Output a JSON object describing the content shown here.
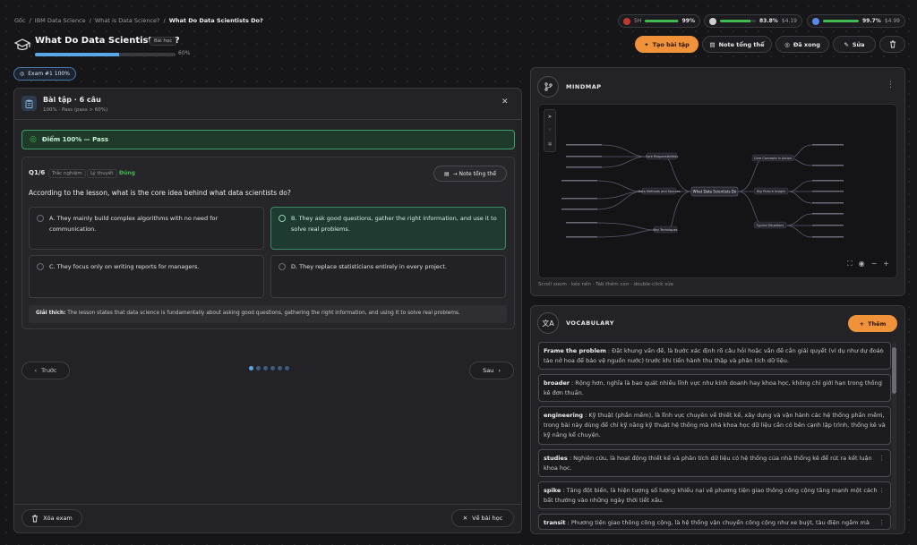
{
  "breadcrumb": [
    "Gốc",
    "IBM Data Science",
    "What is Data Science?",
    "What Do Data Scientists Do?"
  ],
  "breadcrumb_sep": "/",
  "header": {
    "title": "What Do Data Scientists Do?",
    "tag": "Bài học",
    "progress_pct": 60,
    "progress_text": "60%"
  },
  "quotas": [
    {
      "label": "5H",
      "pct": 99,
      "pct_text": "99%",
      "cost": "",
      "icon_color": "#c0392b"
    },
    {
      "label": "",
      "pct": 83.8,
      "pct_text": "83.8%",
      "cost": "$4.19",
      "icon_color": "#d0d0d4"
    },
    {
      "label": "",
      "pct": 99.7,
      "pct_text": "99.7%",
      "cost": "$4.99",
      "icon_color": "#5a8ae8"
    }
  ],
  "toolbar": {
    "create": "Tạo bài tập",
    "note": "Note tổng thể",
    "done": "Đã xong",
    "edit": "Sửa"
  },
  "exam_chip": "Exam #1  100%",
  "quiz": {
    "title": "Bài tập · 6 câu",
    "subtitle": "100% · Pass (pass > 60%)",
    "banner": "Điểm 100% — Pass",
    "q_number": "Q1/6",
    "type": "Trắc nghiệm",
    "category": "Lý thuyết",
    "result": "Đúng",
    "note_button": "→ Note tổng thể",
    "question": "According to the lesson, what is the core idea behind what data scientists do?",
    "options": [
      {
        "text": "A. They mainly build complex algorithms with no need for communication.",
        "correct": false
      },
      {
        "text": "B. They ask good questions, gather the right information, and use it to solve real problems.",
        "correct": true
      },
      {
        "text": "C. They focus only on writing reports for managers.",
        "correct": false
      },
      {
        "text": "D. They replace statisticians entirely in every project.",
        "correct": false
      }
    ],
    "explain_label": "Giải thích:",
    "explain_text": " The lesson states that data science is fundamentally about asking good questions, gathering the right information, and using it to solve real problems.",
    "prev": "Trước",
    "next": "Sau",
    "page_count": 6,
    "active_page": 1,
    "delete": "Xóa exam",
    "back": "Về bài học"
  },
  "mindmap": {
    "title": "MINDMAP",
    "root": "What Data Scientists Do",
    "branches": [
      "Core Responsibilities",
      "Data Methods and Sources",
      "Key Techniques",
      "Core Concepts in Action",
      "Big Picture Insight",
      "Typical Situations"
    ],
    "hint": "Scroll zoom · kéo nền · Tab thêm con · double-click sửa"
  },
  "vocab": {
    "title": "VOCABULARY",
    "add": "Thêm",
    "items": [
      {
        "term": "Frame the problem",
        "def": " : Đặt khung vấn đề, là bước xác định rõ câu hỏi hoặc vấn đề cần giải quyết (ví dụ như dự đoán tảo nở hoa để bảo vệ nguồn nước) trước khi tiến hành thu thập và phân tích dữ liệu."
      },
      {
        "term": "broader",
        "def": " : Rộng hơn, nghĩa là bao quát nhiều lĩnh vực như kinh doanh hay khoa học, không chỉ giới hạn trong thống kê đơn thuần."
      },
      {
        "term": "engineering",
        "def": " : Kỹ thuật (phần mềm), là lĩnh vực chuyên về thiết kế, xây dựng và vận hành các hệ thống phần mềm, trong bài này dùng để chỉ kỹ năng kỹ thuật hệ thống mà nhà khoa học dữ liệu cần có bên cạnh lập trình, thống kê và kỹ năng kể chuyện."
      },
      {
        "term": "studies",
        "def": " : Nghiên cứu, là hoạt động thiết kế và phân tích dữ liệu có hệ thống của nhà thống kê để rút ra kết luận khoa học."
      },
      {
        "term": "spike",
        "def": " : Tăng đột biến, là hiện tượng số lượng khiếu nại về phương tiện giao thông công cộng tăng mạnh một cách bất thường vào những ngày thời tiết xấu."
      },
      {
        "term": "transit",
        "def": " : Phương tiện giao thông công cộng, là hệ thống vận chuyển công cộng như xe buýt, tàu điện ngầm mà"
      }
    ]
  }
}
